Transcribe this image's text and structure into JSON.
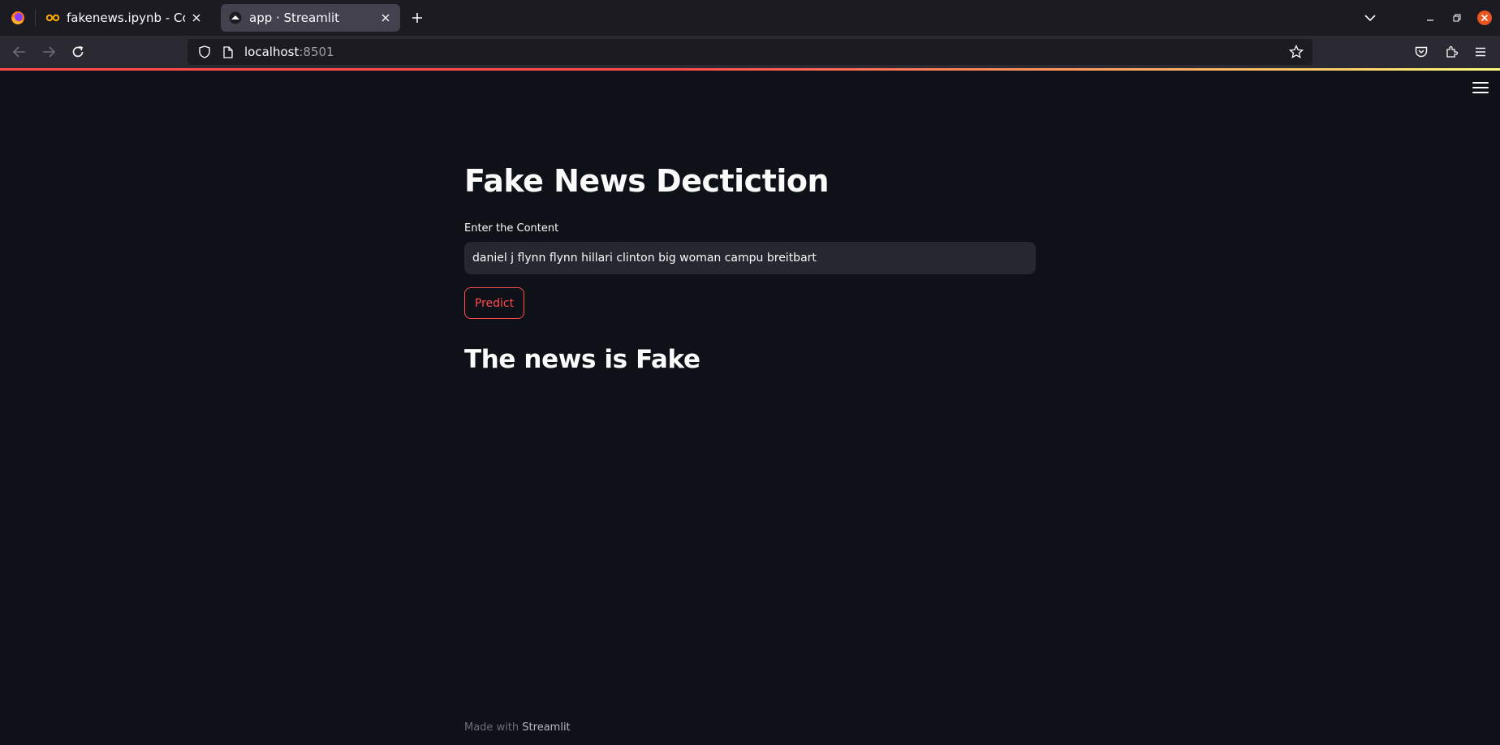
{
  "browser": {
    "tabs": [
      {
        "title": "fakenews.ipynb - Colaboratory",
        "favicon": "colab-icon",
        "active": false
      },
      {
        "title": "app · Streamlit",
        "favicon": "streamlit-icon",
        "active": true
      }
    ],
    "url": {
      "host": "localhost",
      "port": ":8501"
    }
  },
  "app": {
    "title": "Fake News Dectiction",
    "input": {
      "label": "Enter the Content",
      "value": "daniel j flynn flynn hillari clinton big woman campu breitbart"
    },
    "predict_label": "Predict",
    "result": "The news is Fake",
    "footer": {
      "prefix": "Made with",
      "brand": "Streamlit"
    }
  },
  "colors": {
    "background": "#0e1117",
    "accent": "#ff4b4b",
    "input_bg": "#262730",
    "text": "#fafafa"
  }
}
